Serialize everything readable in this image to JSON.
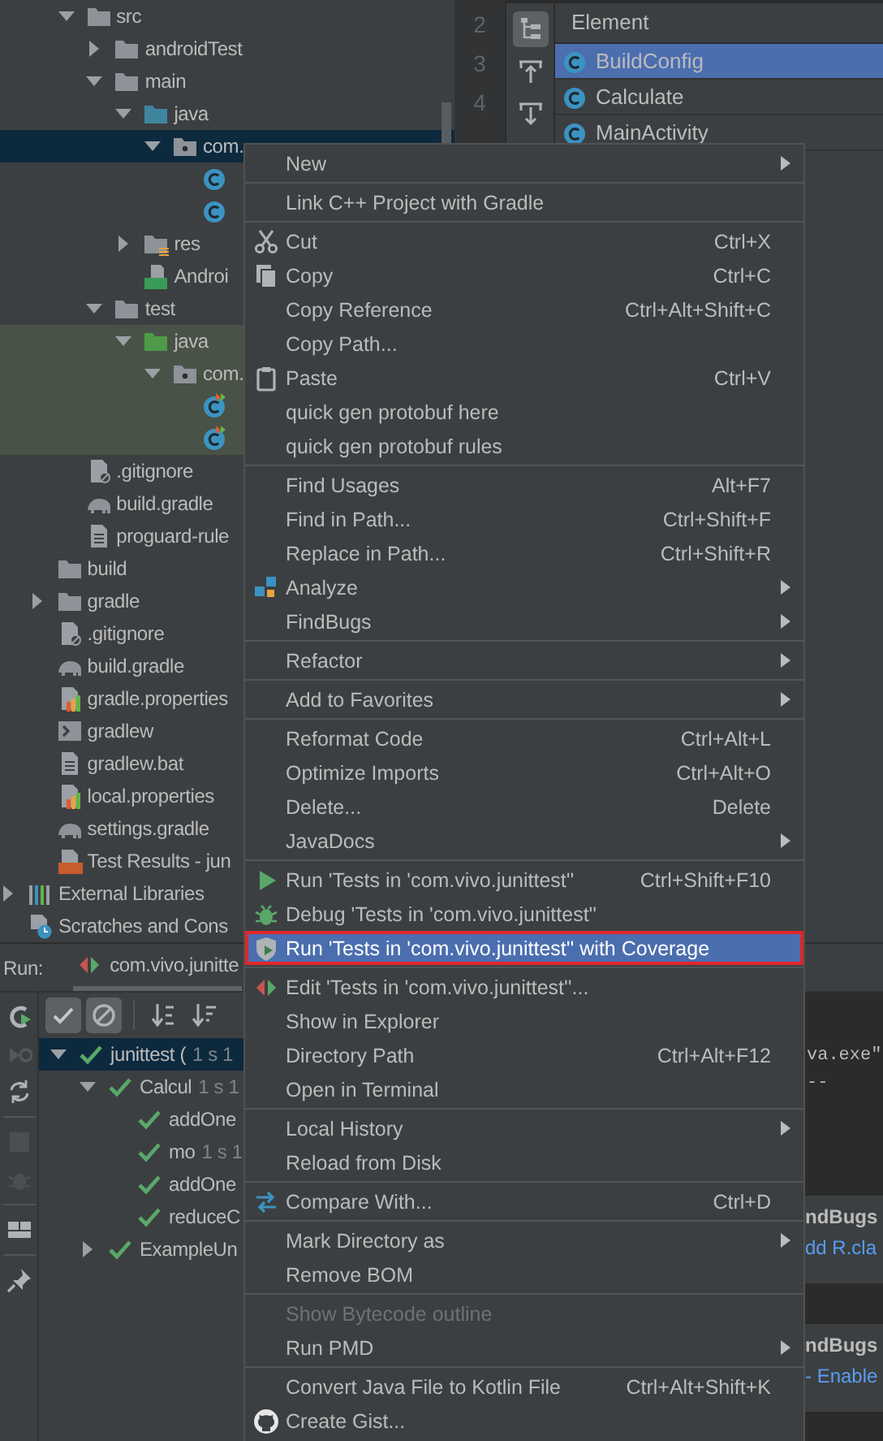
{
  "project_tree": {
    "items": [
      {
        "children": [
          {
            "children": [
              {
                "label": "src",
                "kind": "folder",
                "expanded": true,
                "selected": false,
                "test_source": false,
                "children": [
                  {
                    "label": "androidTest",
                    "kind": "folder",
                    "expanded": false,
                    "selected": false,
                    "test_source": false
                  },
                  {
                    "label": "main",
                    "kind": "folder",
                    "expanded": true,
                    "selected": false,
                    "test_source": false,
                    "children": [
                      {
                        "label": "java",
                        "kind": "source-folder",
                        "expanded": true,
                        "selected": false,
                        "test_source": false,
                        "children": [
                          {
                            "label": "com.",
                            "kind": "package",
                            "expanded": true,
                            "selected": true,
                            "test_source": false,
                            "children": [
                              {
                                "kind": "class",
                                "selected": false,
                                "test_source": false
                              },
                              {
                                "kind": "class",
                                "selected": false,
                                "test_source": false
                              }
                            ]
                          }
                        ]
                      },
                      {
                        "label": "res",
                        "kind": "resources",
                        "expanded": false,
                        "selected": false,
                        "test_source": false
                      },
                      {
                        "label": "Androi",
                        "kind": "manifest",
                        "selected": false,
                        "test_source": false
                      }
                    ]
                  },
                  {
                    "label": "test",
                    "kind": "folder",
                    "expanded": true,
                    "selected": false,
                    "test_source": false,
                    "children": [
                      {
                        "label": "java",
                        "kind": "test-folder",
                        "expanded": true,
                        "selected": false,
                        "test_source": true,
                        "children": [
                          {
                            "label": "com.",
                            "kind": "package",
                            "expanded": true,
                            "selected": false,
                            "test_source": true,
                            "children": [
                              {
                                "kind": "test-class",
                                "selected": false,
                                "test_source": true
                              },
                              {
                                "kind": "test-class",
                                "selected": false,
                                "test_source": true
                              }
                            ]
                          }
                        ]
                      }
                    ]
                  }
                ]
              },
              {
                "label": ".gitignore",
                "kind": "ignore",
                "selected": false,
                "test_source": false
              },
              {
                "label": "build.gradle",
                "kind": "gradle",
                "selected": false,
                "test_source": false
              },
              {
                "label": "proguard-rule",
                "kind": "text",
                "selected": false,
                "test_source": false
              }
            ]
          },
          {
            "label": "build",
            "kind": "folder",
            "selected": false,
            "test_source": false
          },
          {
            "label": "gradle",
            "kind": "folder",
            "expanded": false,
            "selected": false,
            "test_source": false
          },
          {
            "label": ".gitignore",
            "kind": "ignore",
            "selected": false,
            "test_source": false
          },
          {
            "label": "build.gradle",
            "kind": "gradle",
            "selected": false,
            "test_source": false
          },
          {
            "label": "gradle.properties",
            "kind": "properties",
            "selected": false,
            "test_source": false
          },
          {
            "label": "gradlew",
            "kind": "shell",
            "selected": false,
            "test_source": false
          },
          {
            "label": "gradlew.bat",
            "kind": "text",
            "selected": false,
            "test_source": false
          },
          {
            "label": "local.properties",
            "kind": "properties",
            "selected": false,
            "test_source": false
          },
          {
            "label": "settings.gradle",
            "kind": "gradle",
            "selected": false,
            "test_source": false
          },
          {
            "label": "Test Results - jun",
            "kind": "test-results",
            "selected": false,
            "test_source": false
          }
        ]
      },
      {
        "label": "External Libraries",
        "kind": "libraries",
        "expanded": false,
        "selected": false,
        "test_source": false
      },
      {
        "label": "Scratches and Cons",
        "kind": "scratches",
        "selected": false,
        "test_source": false
      }
    ]
  },
  "editor": {
    "line_numbers": [
      "2",
      "3",
      "4"
    ]
  },
  "structure_popup": {
    "tools": [
      {
        "selected": true
      },
      {
        "selected": false
      },
      {
        "selected": false
      }
    ],
    "header": "Element",
    "rows": [
      {
        "label": "BuildConfig",
        "selected": true
      },
      {
        "label": "Calculate",
        "selected": false
      },
      {
        "label": "MainActivity",
        "selected": false
      }
    ]
  },
  "run_panel": {
    "title": "Run:",
    "tabs": [
      {
        "label": "com.vivo.junitte",
        "selected": true
      }
    ],
    "side_tools": [
      {
        "disabled": false
      },
      {
        "disabled": true
      },
      {
        "disabled": false
      },
      {
        "disabled": true
      },
      {
        "disabled": true
      },
      {
        "disabled": false
      },
      {
        "disabled": false
      }
    ],
    "toolbar": [
      {
        "selected": true
      },
      {
        "selected": true
      },
      {
        "selected": false
      },
      {
        "selected": false
      }
    ],
    "tests": [
      {
        "label": "junittest (",
        "time": "1 s 1",
        "passed": true,
        "expanded": true,
        "selected": true,
        "children": [
          {
            "label": "Calcul",
            "time": "1 s 1",
            "passed": true,
            "expanded": true,
            "selected": false,
            "children": [
              {
                "label": "addOne",
                "passed": true,
                "selected": false
              },
              {
                "label": "mo",
                "time": "1 s 1",
                "passed": true,
                "selected": false
              },
              {
                "label": "addOne",
                "passed": true,
                "selected": false
              },
              {
                "label": "reduceC",
                "passed": true,
                "selected": false
              }
            ]
          },
          {
            "label": "ExampleUn",
            "passed": true,
            "expanded": false,
            "selected": false
          }
        ]
      }
    ],
    "console": {
      "lines": [
        "va.exe\"",
        "--"
      ],
      "notifications": [
        {
          "title": "ndBugs",
          "link": "dd R.cla"
        },
        {
          "title": "ndBugs",
          "link": "- Enable"
        }
      ]
    }
  },
  "context_menu": {
    "items": [
      {
        "kind": "item",
        "label": "New",
        "submenu": true,
        "disabled": false,
        "selected": false,
        "outlined": false
      },
      {
        "kind": "separator"
      },
      {
        "kind": "item",
        "label": "Link C++ Project with Gradle",
        "submenu": false,
        "disabled": false,
        "selected": false,
        "outlined": false
      },
      {
        "kind": "separator"
      },
      {
        "kind": "item",
        "label": "Cut",
        "shortcut": "Ctrl+X",
        "submenu": false,
        "disabled": false,
        "selected": false,
        "outlined": false
      },
      {
        "kind": "item",
        "label": "Copy",
        "shortcut": "Ctrl+C",
        "submenu": false,
        "disabled": false,
        "selected": false,
        "outlined": false
      },
      {
        "kind": "item",
        "label": "Copy Reference",
        "shortcut": "Ctrl+Alt+Shift+C",
        "submenu": false,
        "disabled": false,
        "selected": false,
        "outlined": false
      },
      {
        "kind": "item",
        "label": "Copy Path...",
        "submenu": false,
        "disabled": false,
        "selected": false,
        "outlined": false
      },
      {
        "kind": "item",
        "label": "Paste",
        "shortcut": "Ctrl+V",
        "submenu": false,
        "disabled": false,
        "selected": false,
        "outlined": false
      },
      {
        "kind": "item",
        "label": "quick gen protobuf here",
        "submenu": false,
        "disabled": false,
        "selected": false,
        "outlined": false
      },
      {
        "kind": "item",
        "label": "quick gen protobuf rules",
        "submenu": false,
        "disabled": false,
        "selected": false,
        "outlined": false
      },
      {
        "kind": "separator"
      },
      {
        "kind": "item",
        "label": "Find Usages",
        "shortcut": "Alt+F7",
        "submenu": false,
        "disabled": false,
        "selected": false,
        "outlined": false
      },
      {
        "kind": "item",
        "label": "Find in Path...",
        "shortcut": "Ctrl+Shift+F",
        "submenu": false,
        "disabled": false,
        "selected": false,
        "outlined": false
      },
      {
        "kind": "item",
        "label": "Replace in Path...",
        "shortcut": "Ctrl+Shift+R",
        "submenu": false,
        "disabled": false,
        "selected": false,
        "outlined": false
      },
      {
        "kind": "item",
        "label": "Analyze",
        "submenu": true,
        "disabled": false,
        "selected": false,
        "outlined": false
      },
      {
        "kind": "item",
        "label": "FindBugs",
        "submenu": true,
        "disabled": false,
        "selected": false,
        "outlined": false
      },
      {
        "kind": "separator"
      },
      {
        "kind": "item",
        "label": "Refactor",
        "submenu": true,
        "disabled": false,
        "selected": false,
        "outlined": false
      },
      {
        "kind": "separator"
      },
      {
        "kind": "item",
        "label": "Add to Favorites",
        "submenu": true,
        "disabled": false,
        "selected": false,
        "outlined": false
      },
      {
        "kind": "separator"
      },
      {
        "kind": "item",
        "label": "Reformat Code",
        "shortcut": "Ctrl+Alt+L",
        "submenu": false,
        "disabled": false,
        "selected": false,
        "outlined": false
      },
      {
        "kind": "item",
        "label": "Optimize Imports",
        "shortcut": "Ctrl+Alt+O",
        "submenu": false,
        "disabled": false,
        "selected": false,
        "outlined": false
      },
      {
        "kind": "item",
        "label": "Delete...",
        "shortcut": "Delete",
        "submenu": false,
        "disabled": false,
        "selected": false,
        "outlined": false
      },
      {
        "kind": "item",
        "label": "JavaDocs",
        "submenu": true,
        "disabled": false,
        "selected": false,
        "outlined": false
      },
      {
        "kind": "separator"
      },
      {
        "kind": "item",
        "label": "Run 'Tests in 'com.vivo.junittest''",
        "shortcut": "Ctrl+Shift+F10",
        "submenu": false,
        "disabled": false,
        "selected": false,
        "outlined": false
      },
      {
        "kind": "item",
        "label": "Debug 'Tests in 'com.vivo.junittest''",
        "submenu": false,
        "disabled": false,
        "selected": false,
        "outlined": false
      },
      {
        "kind": "item",
        "label": "Run 'Tests in 'com.vivo.junittest'' with Coverage",
        "submenu": false,
        "disabled": false,
        "selected": true,
        "outlined": true
      },
      {
        "kind": "separator"
      },
      {
        "kind": "item",
        "label": "Edit 'Tests in 'com.vivo.junittest''...",
        "submenu": false,
        "disabled": false,
        "selected": false,
        "outlined": false
      },
      {
        "kind": "item",
        "label": "Show in Explorer",
        "submenu": false,
        "disabled": false,
        "selected": false,
        "outlined": false
      },
      {
        "kind": "item",
        "label": "Directory Path",
        "shortcut": "Ctrl+Alt+F12",
        "submenu": false,
        "disabled": false,
        "selected": false,
        "outlined": false
      },
      {
        "kind": "item",
        "label": "Open in Terminal",
        "submenu": false,
        "disabled": false,
        "selected": false,
        "outlined": false
      },
      {
        "kind": "separator"
      },
      {
        "kind": "item",
        "label": "Local History",
        "submenu": true,
        "disabled": false,
        "selected": false,
        "outlined": false
      },
      {
        "kind": "item",
        "label": "Reload from Disk",
        "submenu": false,
        "disabled": false,
        "selected": false,
        "outlined": false
      },
      {
        "kind": "separator"
      },
      {
        "kind": "item",
        "label": "Compare With...",
        "shortcut": "Ctrl+D",
        "submenu": false,
        "disabled": false,
        "selected": false,
        "outlined": false
      },
      {
        "kind": "separator"
      },
      {
        "kind": "item",
        "label": "Mark Directory as",
        "submenu": true,
        "disabled": false,
        "selected": false,
        "outlined": false
      },
      {
        "kind": "item",
        "label": "Remove BOM",
        "submenu": false,
        "disabled": false,
        "selected": false,
        "outlined": false
      },
      {
        "kind": "separator"
      },
      {
        "kind": "item",
        "label": "Show Bytecode outline",
        "submenu": false,
        "disabled": true,
        "selected": false,
        "outlined": false
      },
      {
        "kind": "item",
        "label": "Run PMD",
        "submenu": true,
        "disabled": false,
        "selected": false,
        "outlined": false
      },
      {
        "kind": "separator"
      },
      {
        "kind": "item",
        "label": "Convert Java File to Kotlin File",
        "shortcut": "Ctrl+Alt+Shift+K",
        "submenu": false,
        "disabled": false,
        "selected": false,
        "outlined": false
      },
      {
        "kind": "item",
        "label": "Create Gist...",
        "submenu": false,
        "disabled": false,
        "selected": false,
        "outlined": false
      }
    ]
  }
}
